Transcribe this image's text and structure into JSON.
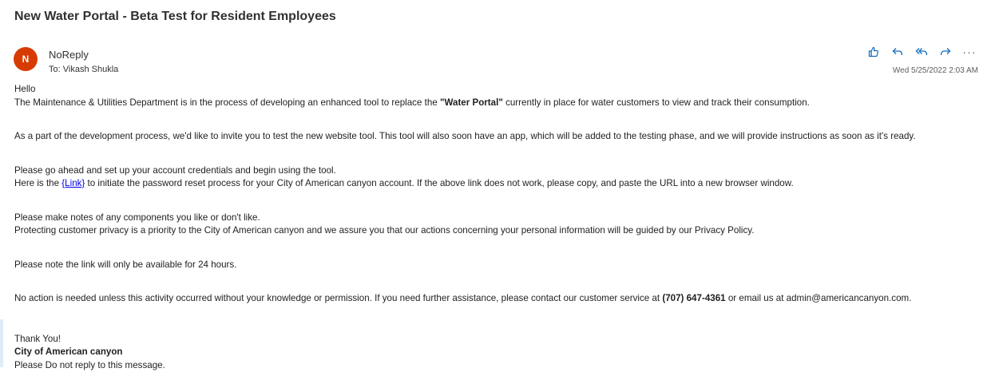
{
  "subject": "New Water Portal - Beta Test for Resident Employees",
  "sender": {
    "initial": "N",
    "avatar_color": "#d83b01",
    "name": "NoReply",
    "to_label": "To:",
    "to_name": "Vikash Shukla"
  },
  "timestamp": "Wed 5/25/2022 2:03 AM",
  "actions": {
    "like": "like-icon",
    "reply": "reply-icon",
    "reply_all": "reply-all-icon",
    "forward": "forward-icon",
    "more": "···"
  },
  "body": {
    "greeting": "Hello",
    "p1_pre": "The Maintenance & Utilities Department is in the process of developing an enhanced tool to replace the ",
    "p1_bold": "\"Water Portal\"",
    "p1_post": " currently in place for water customers to view and track their consumption.",
    "p2": "As a part of the development process, we'd like to invite you to test the new website tool. This tool will also soon have an app, which will be added to the testing phase, and we will provide instructions as soon as it's ready.",
    "p3a": "Please go ahead and set up your account credentials and begin using the tool.",
    "p3b_pre": "Here is the ",
    "p3b_link": "{Link}",
    "p3b_post": " to initiate the password reset process for your City of American canyon account. If the above link does not work, please copy, and paste the URL into a new browser window.",
    "p4a": "Please make notes of any components you like or don't like.",
    "p4b": "Protecting customer privacy is a priority to the City of American canyon and we assure you that our actions concerning your personal information will be guided by our Privacy Policy.",
    "p5": "Please note the link will only be available for 24 hours.",
    "p6_pre": "No action is needed unless this activity occurred without your knowledge or permission. If you need further assistance, please contact our customer service at ",
    "p6_phone": "(707) 647-4361",
    "p6_post": " or email us at admin@americancanyon.com.",
    "thanks": "Thank You!",
    "signature": "City of American canyon",
    "footer": "Please Do not reply to this message."
  }
}
